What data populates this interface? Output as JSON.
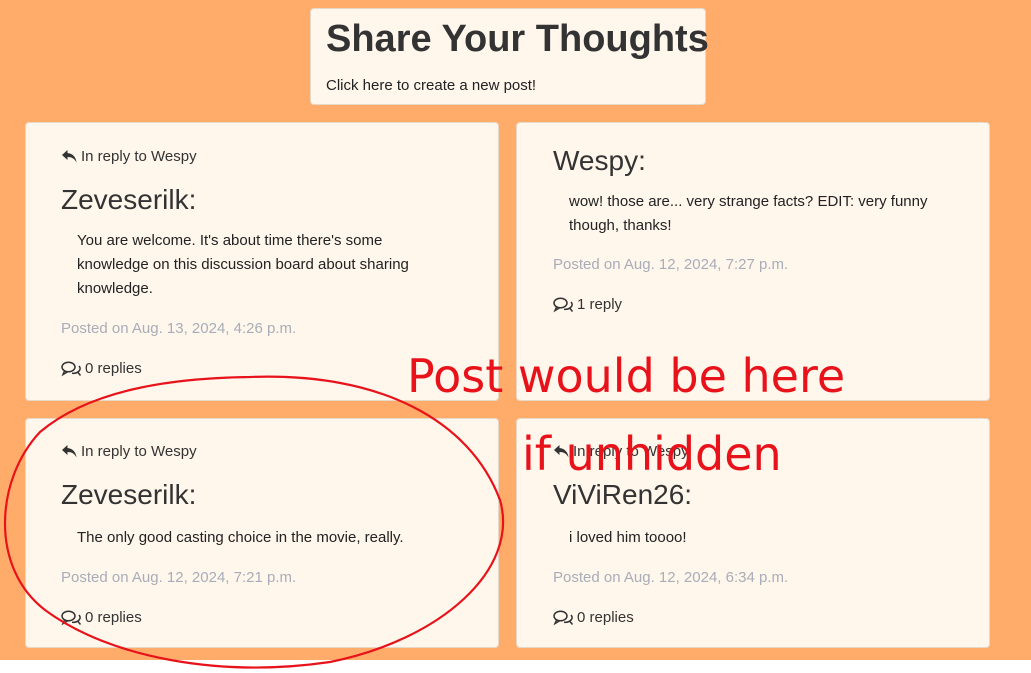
{
  "header": {
    "title": "Share Your Thoughts",
    "create_link": "Click here to create a new post!"
  },
  "posts": [
    {
      "reply_to": "In reply to Wespy",
      "author": "Zeveserilk:",
      "body": "You are welcome. It's about time there's some knowledge on this discussion board about sharing knowledge.",
      "posted": "Posted on Aug. 13, 2024, 4:26 p.m.",
      "replies": "0 replies"
    },
    {
      "reply_to": "",
      "author": "Wespy:",
      "body": "wow! those are... very strange facts? EDIT: very funny though, thanks!",
      "posted": "Posted on Aug. 12, 2024, 7:27 p.m.",
      "replies": "1 reply"
    },
    {
      "reply_to": "In reply to Wespy",
      "author": "Zeveserilk:",
      "body": "The only good casting choice in the movie, really.",
      "posted": "Posted on Aug. 12, 2024, 7:21 p.m.",
      "replies": "0 replies"
    },
    {
      "reply_to": "In reply to Wespy",
      "author": "ViViRen26:",
      "body": "i loved him toooo!",
      "posted": "Posted on Aug. 12, 2024, 6:34 p.m.",
      "replies": "0 replies"
    }
  ],
  "annotation": {
    "line1": "Post would be here",
    "line2": "if unhidden",
    "color": "#e8121a"
  },
  "colors": {
    "page_background": "#ffac6b",
    "card_background": "#fff6ec",
    "muted_text": "#a8adb8"
  },
  "icons": {
    "reply": "reply-arrow-icon",
    "replies": "comments-icon"
  }
}
